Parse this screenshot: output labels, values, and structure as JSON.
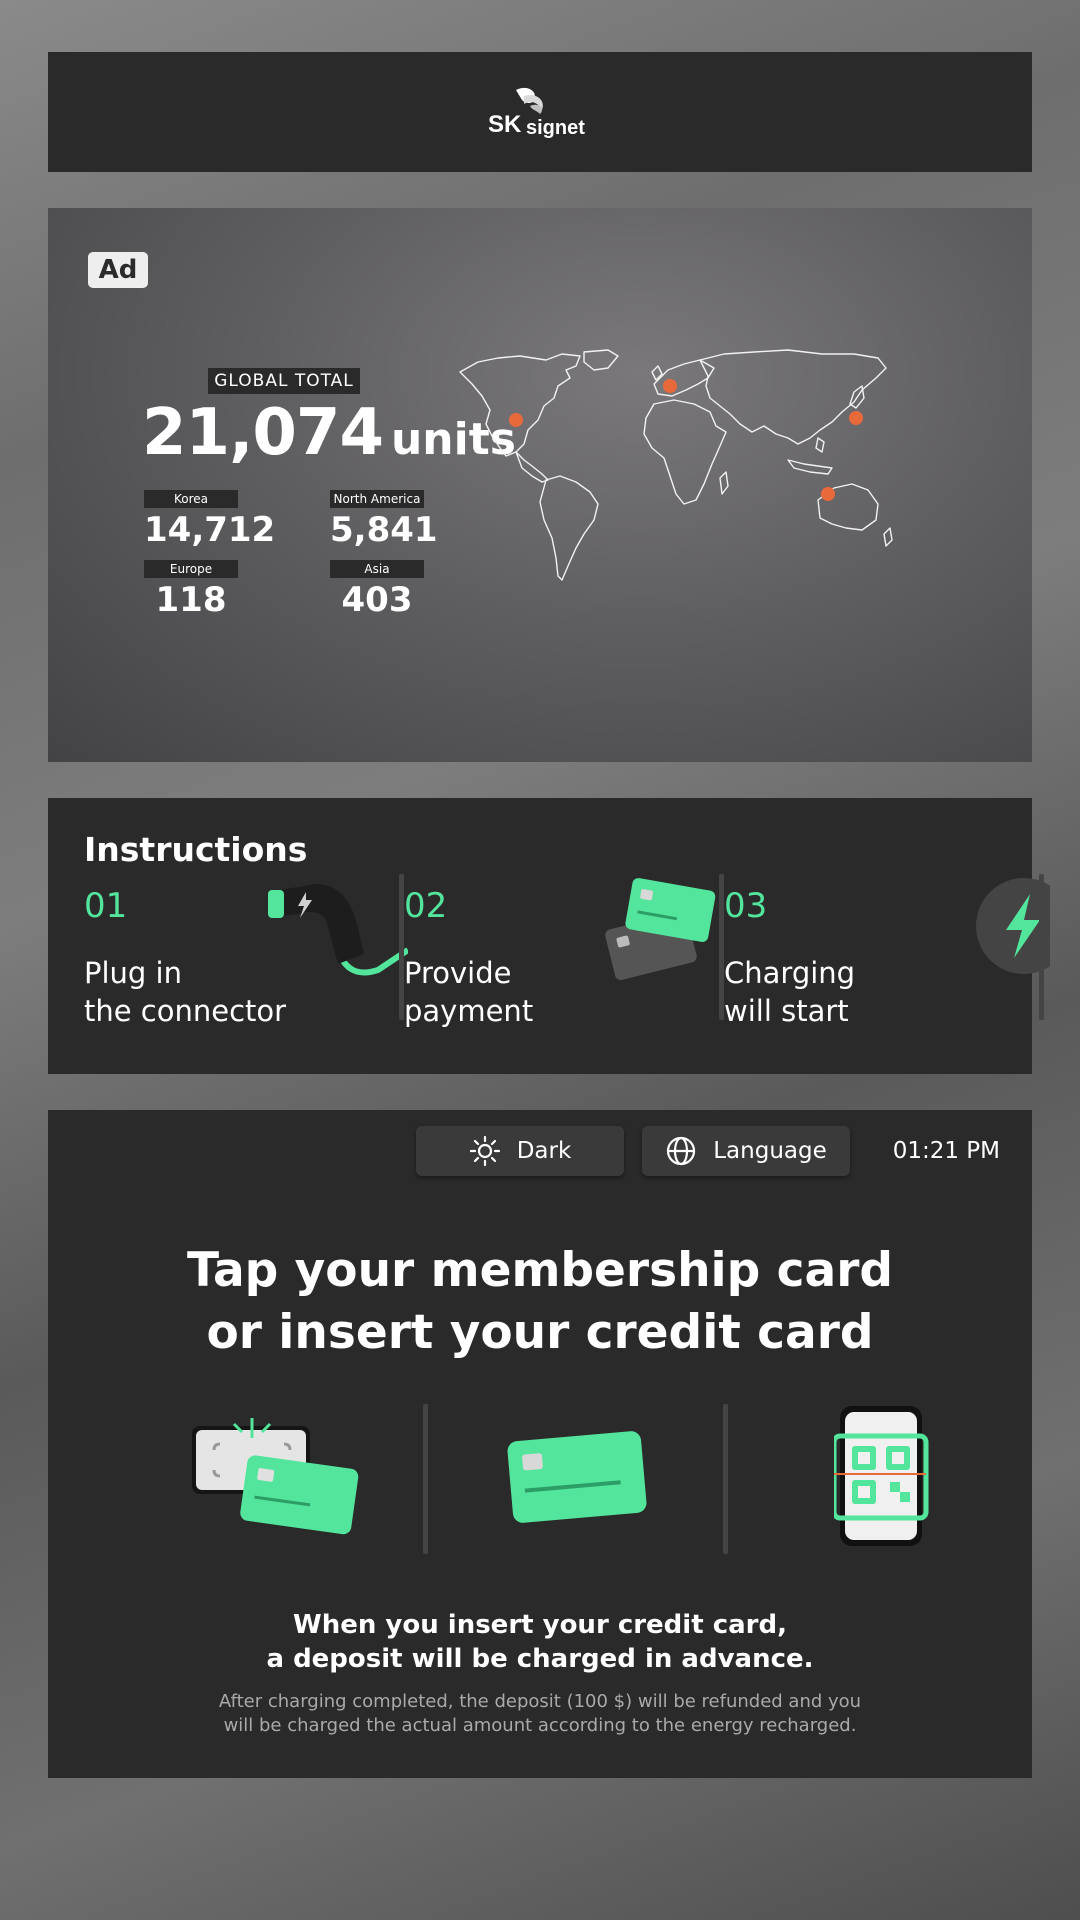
{
  "header": {
    "logo_text": "SK signet"
  },
  "ad": {
    "badge": "Ad",
    "global_label": "GLOBAL TOTAL",
    "global_total": "21,074",
    "global_unit": "units",
    "regions": [
      {
        "label": "Korea",
        "value": "14,712"
      },
      {
        "label": "North America",
        "value": "5,841"
      },
      {
        "label": "Europe",
        "value": "118"
      },
      {
        "label": "Asia",
        "value": "403"
      }
    ],
    "marker_color": "#e8693a"
  },
  "instructions": {
    "title": "Instructions",
    "steps": [
      {
        "number": "01",
        "line1": "Plug in",
        "line2": "the connector",
        "icon": "ev-connector-icon"
      },
      {
        "number": "02",
        "line1": "Provide",
        "line2": "payment",
        "icon": "credit-cards-icon"
      },
      {
        "number": "03",
        "line1": "Charging",
        "line2": "will start",
        "icon": "lightning-icon"
      }
    ]
  },
  "payment": {
    "dark_label": "Dark",
    "language_label": "Language",
    "time": "01:21 PM",
    "title_line1": "Tap your membership card",
    "title_line2": "or insert your credit card",
    "methods": [
      "card-tap-icon",
      "credit-card-icon",
      "qr-phone-icon"
    ],
    "note_line1": "When you insert your credit card,",
    "note_line2": "a deposit will be charged in advance.",
    "sub_line1": "After charging completed, the deposit (100 $) will be refunded and you",
    "sub_line2": "will be charged the actual amount according to the energy recharged."
  },
  "colors": {
    "accent": "#52e59b",
    "panel": "#2a2a2a",
    "marker": "#e8693a"
  }
}
